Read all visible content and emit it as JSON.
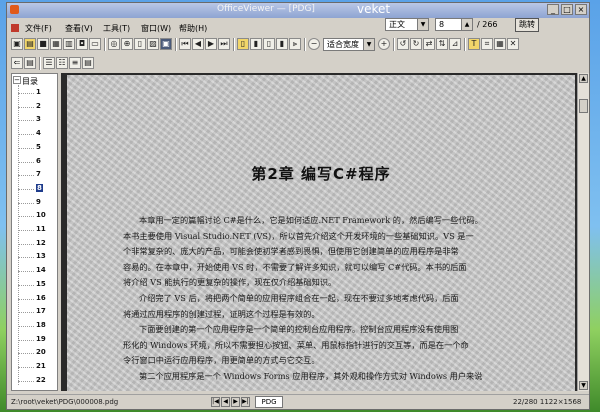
{
  "window": {
    "title": "OfficeViewer — [PDG]",
    "brand": "veket",
    "controls": [
      "_",
      "□",
      "×"
    ]
  },
  "top_controls": {
    "view_mode": "正文",
    "page_number": "8",
    "page_total": "/ 266",
    "jump_label": "跳转"
  },
  "menu": {
    "items": [
      "文件(F)",
      "查看(V)",
      "工具(T)",
      "窗口(W)",
      "帮助(H)"
    ]
  },
  "toolbar": {
    "zoom_value": "适合宽度"
  },
  "sidebar": {
    "header": "目录",
    "items": [
      "1",
      "2",
      "3",
      "4",
      "5",
      "6",
      "7",
      "8",
      "9",
      "10",
      "11",
      "12",
      "13",
      "14",
      "15",
      "16",
      "17",
      "18",
      "19",
      "20",
      "21",
      "22"
    ],
    "selected": "8"
  },
  "document": {
    "chapter_title": "第2章    编写C#程序",
    "paragraph1": [
      "本章用一定的篇幅讨论 C#是什么，它是如何适应.NET Framework 的，然后编写一些代码。",
      "本书主要使用 Visual Studio.NET (VS)，所以首先介绍这个开发环境的一些基础知识。VS 是一",
      "个非常复杂的、庞大的产品，可能会使初学者感到畏惧，但使用它创建简单的应用程序是非常",
      "容易的。在本章中，开始使用 VS 时，不需要了解许多知识，就可以编写 C#代码。本书的后面",
      "将介绍 VS 能执行的更复杂的操作，现在仅介绍基础知识。"
    ],
    "paragraph2": [
      "介绍完了 VS 后，将把两个简单的应用程序组合在一起，现在不要过多地考虑代码，后面",
      "将通过应用程序的创建过程，证明这个过程是有效的。"
    ],
    "paragraph3": [
      "下面要创建的第一个应用程序是一个简单的控制台应用程序。控制台应用程序没有使用图",
      "形化的 Windows 环境，所以不需要担心按钮、菜单、用鼠标指针进行的交互等，而是在一个命",
      "令行窗口中运行应用程序，用更简单的方式与它交互。"
    ],
    "paragraph4": [
      "第二个应用程序是一个 Windows Forms 应用程序，其外观和操作方式对 Windows 用户来说"
    ]
  },
  "statusbar": {
    "path": "Z:\\root\\veket\\PDG\\000008.pdg",
    "tab_label": "PDG",
    "page_info": "22/280",
    "size_info": "1122×1568"
  }
}
